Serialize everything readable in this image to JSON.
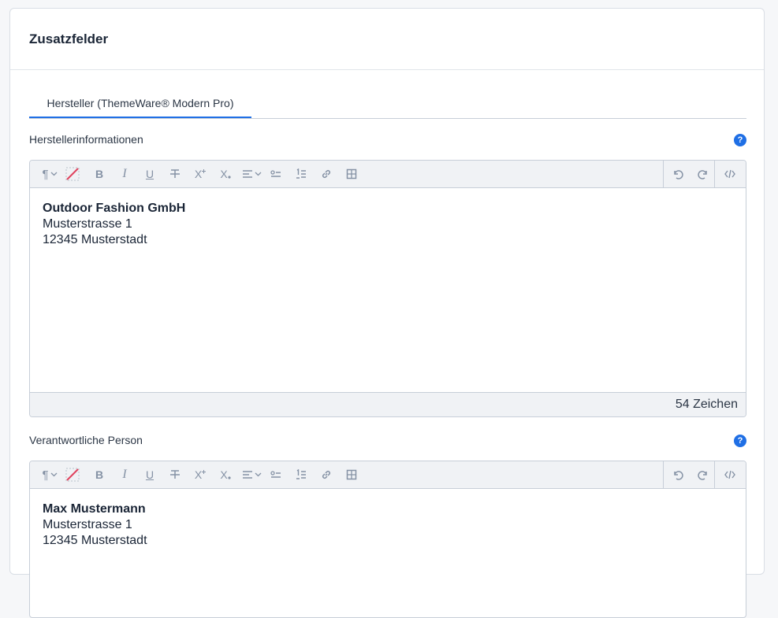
{
  "card": {
    "title": "Zusatzfelder"
  },
  "tabs": [
    {
      "label": "Hersteller (ThemeWare® Modern Pro)"
    }
  ],
  "fields": [
    {
      "label": "Herstellerinformationen",
      "help": "?",
      "content": {
        "line1": "Outdoor Fashion GmbH",
        "line2": "Musterstrasse 1",
        "line3": "12345 Musterstadt"
      },
      "char_count": "54 Zeichen"
    },
    {
      "label": "Verantwortliche Person",
      "help": "?",
      "content": {
        "line1": "Max Mustermann",
        "line2": "Musterstrasse 1",
        "line3": "12345 Musterstadt"
      }
    }
  ],
  "toolbar": {
    "icons": [
      "paragraph-format-icon",
      "clear-format-icon",
      "bold-icon",
      "italic-icon",
      "underline-icon",
      "strikethrough-icon",
      "superscript-icon",
      "subscript-icon",
      "align-icon",
      "bullet-list-icon",
      "numbered-list-icon",
      "link-icon",
      "table-icon",
      "undo-icon",
      "redo-icon",
      "code-view-icon"
    ],
    "glyphs": {
      "paragraph": "¶",
      "bold": "B",
      "italic": "I",
      "underline": "U",
      "superscript": "X",
      "subscript": "X"
    }
  },
  "colors": {
    "accent": "#1f6fe5",
    "icon": "#8592a5",
    "clear_slash": "#e0445f"
  }
}
